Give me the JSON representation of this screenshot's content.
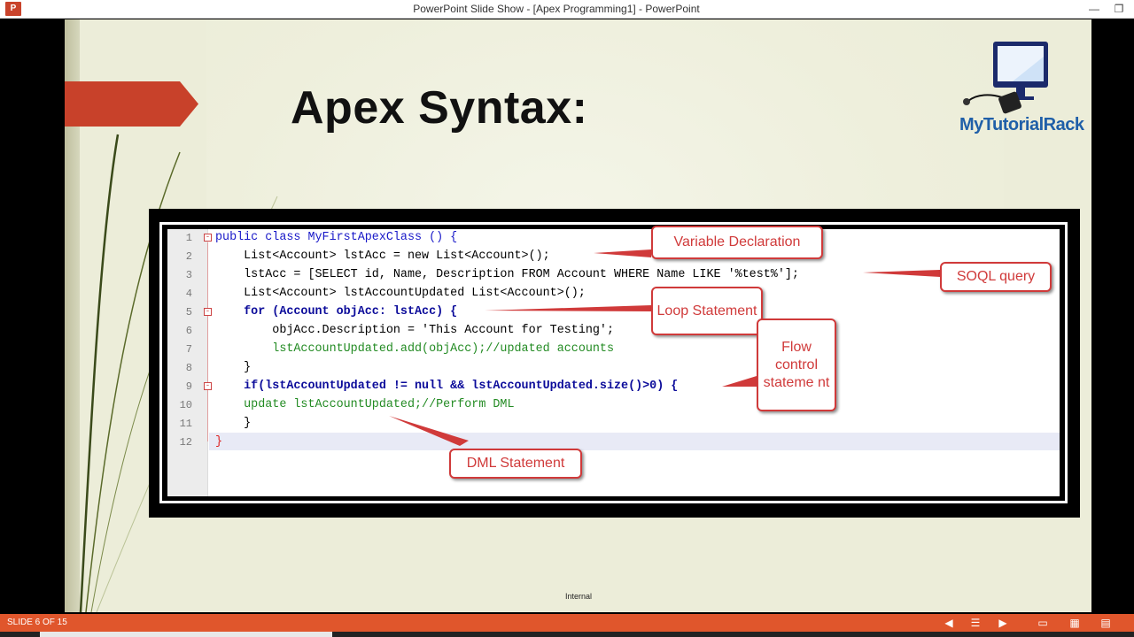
{
  "window": {
    "title": "PowerPoint Slide Show - [Apex Programming1] - PowerPoint",
    "app_icon_label": "P",
    "minimize_glyph": "—",
    "restore_glyph": "❐"
  },
  "slide": {
    "title": "Apex Syntax:",
    "logo_text": "MyTutorialRack",
    "footer_label": "Internal"
  },
  "code": {
    "line_numbers": [
      "1",
      "2",
      "3",
      "4",
      "5",
      "6",
      "7",
      "8",
      "9",
      "10",
      "11",
      "12"
    ],
    "lines": [
      "public class MyFirstApexClass () {",
      "    List<Account> lstAcc = new List<Account>();",
      "    lstAcc = [SELECT id, Name, Description FROM Account WHERE Name LIKE '%test%'];",
      "    List<Account> lstAccountUpdated List<Account>();",
      "    for (Account objAcc: lstAcc) {",
      "        objAcc.Description = 'This Account for Testing';",
      "        lstAccountUpdated.add(objAcc);//updated accounts",
      "    }",
      "    if(lstAccountUpdated != null && lstAccountUpdated.size()>0) {",
      "    update lstAccountUpdated;//Perform DML",
      "    }",
      "}"
    ]
  },
  "callouts": {
    "variable_declaration": "Variable Declaration",
    "soql_query": "SOQL query",
    "loop_statement": "Loop Statement",
    "flow_control": "Flow control stateme nt",
    "dml_statement": "DML Statement"
  },
  "statusbar": {
    "slide_counter": "SLIDE 6 OF 15",
    "prev_glyph": "◀",
    "notes_glyph": "☰",
    "next_glyph": "▶",
    "normal_view_glyph": "▭",
    "sorter_glyph": "▦",
    "reading_view_glyph": "▤"
  },
  "colors": {
    "accent_orange": "#e0562c",
    "banner_red": "#c8412a",
    "callout_red": "#d03a3a",
    "logo_blue": "#1f5fa8"
  }
}
